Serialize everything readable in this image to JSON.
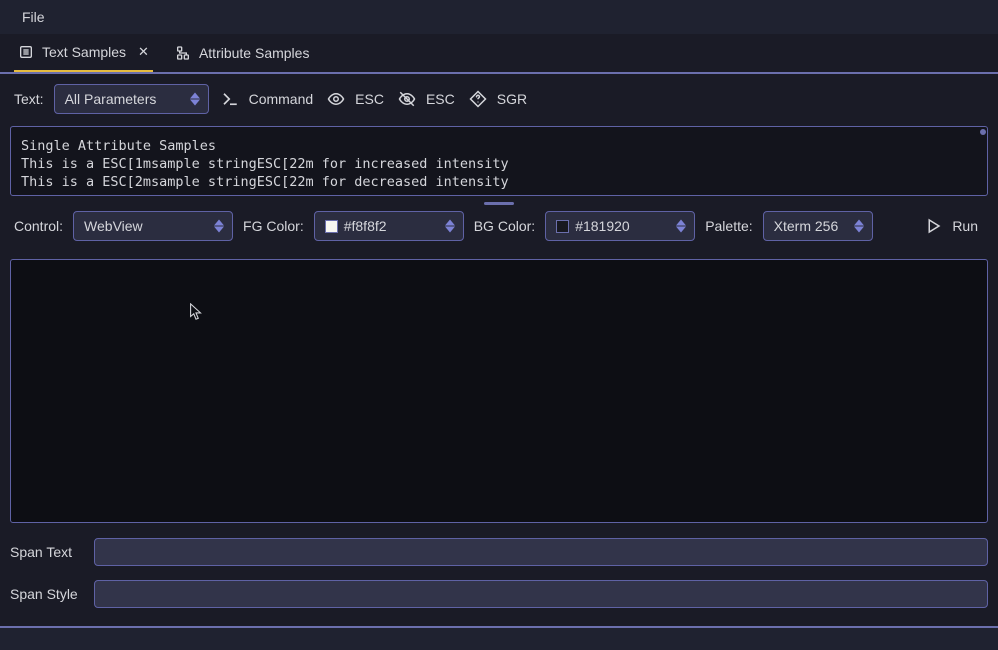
{
  "menu": {
    "file": "File"
  },
  "tabs": [
    {
      "label": "Text Samples",
      "active": true
    },
    {
      "label": "Attribute Samples",
      "active": false
    }
  ],
  "row1": {
    "text_label": "Text:",
    "text_value": "All Parameters",
    "buttons": {
      "command": "Command",
      "esc_visible": "ESC",
      "esc_hidden": "ESC",
      "sgr": "SGR"
    }
  },
  "code_lines": [
    "Single Attribute Samples",
    "This is a ESC[1msample stringESC[22m for increased intensity",
    "This is a ESC[2msample stringESC[22m for decreased intensity"
  ],
  "row2": {
    "control_label": "Control:",
    "control_value": "WebView",
    "fg_label": "FG Color:",
    "fg_value": "#f8f8f2",
    "bg_label": "BG Color:",
    "bg_value": "#181920",
    "palette_label": "Palette:",
    "palette_value": "Xterm 256",
    "run": "Run"
  },
  "span": {
    "text_label": "Span Text",
    "style_label": "Span Style",
    "text_value": "",
    "style_value": ""
  },
  "colors": {
    "fg_swatch": "#f8f8f2",
    "bg_swatch": "#181920"
  }
}
